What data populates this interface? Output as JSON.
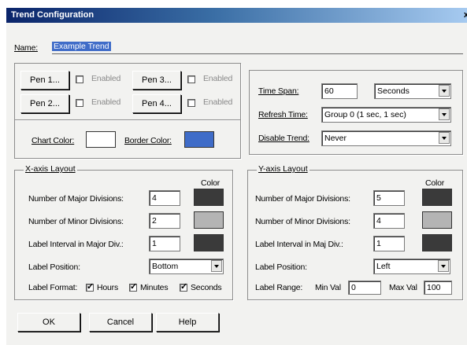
{
  "window": {
    "title": "Trend Configuration",
    "close": "x"
  },
  "name": {
    "label": "Name:",
    "value": "Example Trend"
  },
  "pens": [
    {
      "button": "Pen 1...",
      "enabled_label": "Enabled",
      "enabled": false
    },
    {
      "button": "Pen 3...",
      "enabled_label": "Enabled",
      "enabled": false
    },
    {
      "button": "Pen 2...",
      "enabled_label": "Enabled",
      "enabled": false
    },
    {
      "button": "Pen 4...",
      "enabled_label": "Enabled",
      "enabled": false
    }
  ],
  "colors": {
    "chart_color_label": "Chart Color:",
    "chart_color": "#ffffff",
    "border_color_label": "Border Color:",
    "border_color": "#3f6cc8"
  },
  "timing": {
    "time_span_label": "Time Span:",
    "time_span_value": "60",
    "time_span_unit": "Seconds",
    "refresh_label": "Refresh Time:",
    "refresh_value": "Group 0 (1 sec, 1 sec)",
    "disable_label": "Disable Trend:",
    "disable_value": "Never"
  },
  "xaxis": {
    "title": "X-axis Layout",
    "color_header": "Color",
    "major_label": "Number of Major Divisions:",
    "major_value": "4",
    "major_color": "#3a3a3a",
    "minor_label": "Number of Minor Divisions:",
    "minor_value": "2",
    "minor_color": "#b4b4b4",
    "interval_label": "Label Interval in Major Div.:",
    "interval_value": "1",
    "interval_color": "#3a3a3a",
    "position_label": "Label Position:",
    "position_value": "Bottom",
    "format_label": "Label Format:",
    "hours_label": "Hours",
    "minutes_label": "Minutes",
    "seconds_label": "Seconds"
  },
  "yaxis": {
    "title": "Y-axis Layout",
    "color_header": "Color",
    "major_label": "Number of Major Divisions:",
    "major_value": "5",
    "major_color": "#3a3a3a",
    "minor_label": "Number of Minor Divisions:",
    "minor_value": "4",
    "minor_color": "#b4b4b4",
    "interval_label": "Label Interval in Maj Div.:",
    "interval_value": "1",
    "interval_color": "#3a3a3a",
    "position_label": "Label Position:",
    "position_value": "Left",
    "range_label": "Label Range:",
    "min_label": "Min Val",
    "min_value": "0",
    "max_label": "Max Val",
    "max_value": "100"
  },
  "buttons": {
    "ok": "OK",
    "cancel": "Cancel",
    "help": "Help"
  }
}
